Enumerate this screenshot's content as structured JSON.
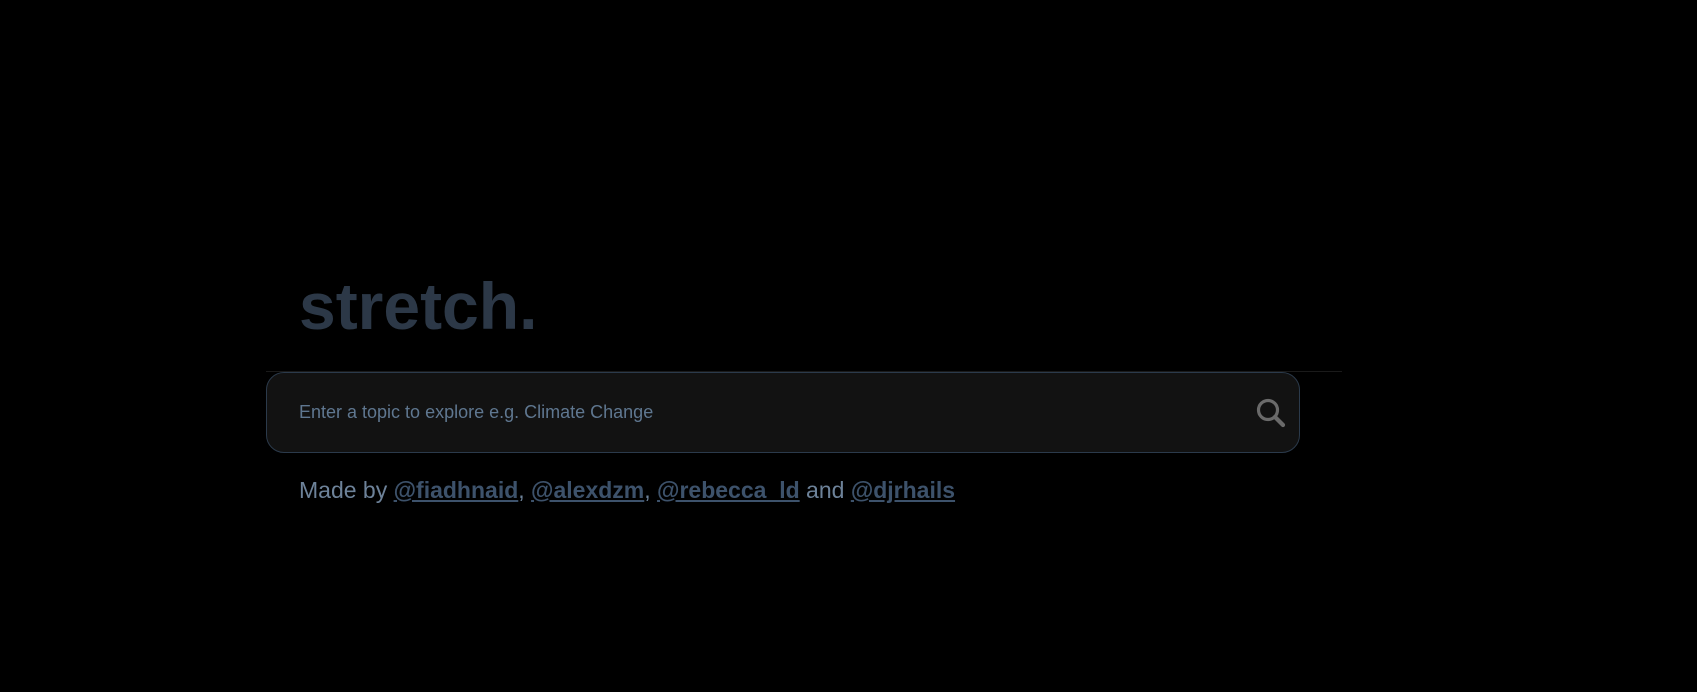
{
  "app": {
    "logo_text": "stretch."
  },
  "search": {
    "placeholder": "Enter a topic to explore e.g. Climate Change",
    "value": ""
  },
  "icons": {
    "search": "search-icon"
  },
  "colors": {
    "background": "#000000",
    "logo": "#2c3847",
    "input_background": "#121212",
    "input_border": "#2b3a4b",
    "link": "#3d526b",
    "text": "#6d8299"
  },
  "credits": {
    "prefix": "Made by",
    "sep1": ",",
    "sep2": ",",
    "conjunction": "and",
    "authors": [
      {
        "handle": "@fiadhnaid"
      },
      {
        "handle": "@alexdzm"
      },
      {
        "handle": "@rebecca_ld"
      },
      {
        "handle": "@djrhails"
      }
    ]
  }
}
